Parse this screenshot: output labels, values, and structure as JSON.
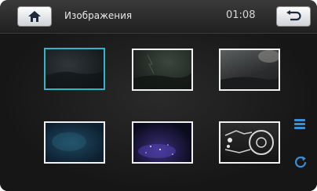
{
  "header": {
    "title": "Изображения",
    "time": "01:08",
    "home_icon": "home-icon",
    "back_icon": "back-arrow-icon"
  },
  "gallery": {
    "items": [
      {
        "name": "photo-thumbnail-1",
        "selected": true
      },
      {
        "name": "photo-thumbnail-2",
        "selected": false
      },
      {
        "name": "photo-thumbnail-3",
        "selected": false
      },
      {
        "name": "photo-thumbnail-4",
        "selected": false
      },
      {
        "name": "photo-thumbnail-5",
        "selected": false
      },
      {
        "name": "photo-thumbnail-6",
        "selected": false
      }
    ]
  },
  "sidebar": {
    "list_icon": "list-view-icon",
    "refresh_icon": "refresh-icon"
  },
  "colors": {
    "background": "#1b1b1b",
    "selection": "#2fb7c9",
    "accent": "#3a8fd6",
    "button": "#e8ebee"
  }
}
